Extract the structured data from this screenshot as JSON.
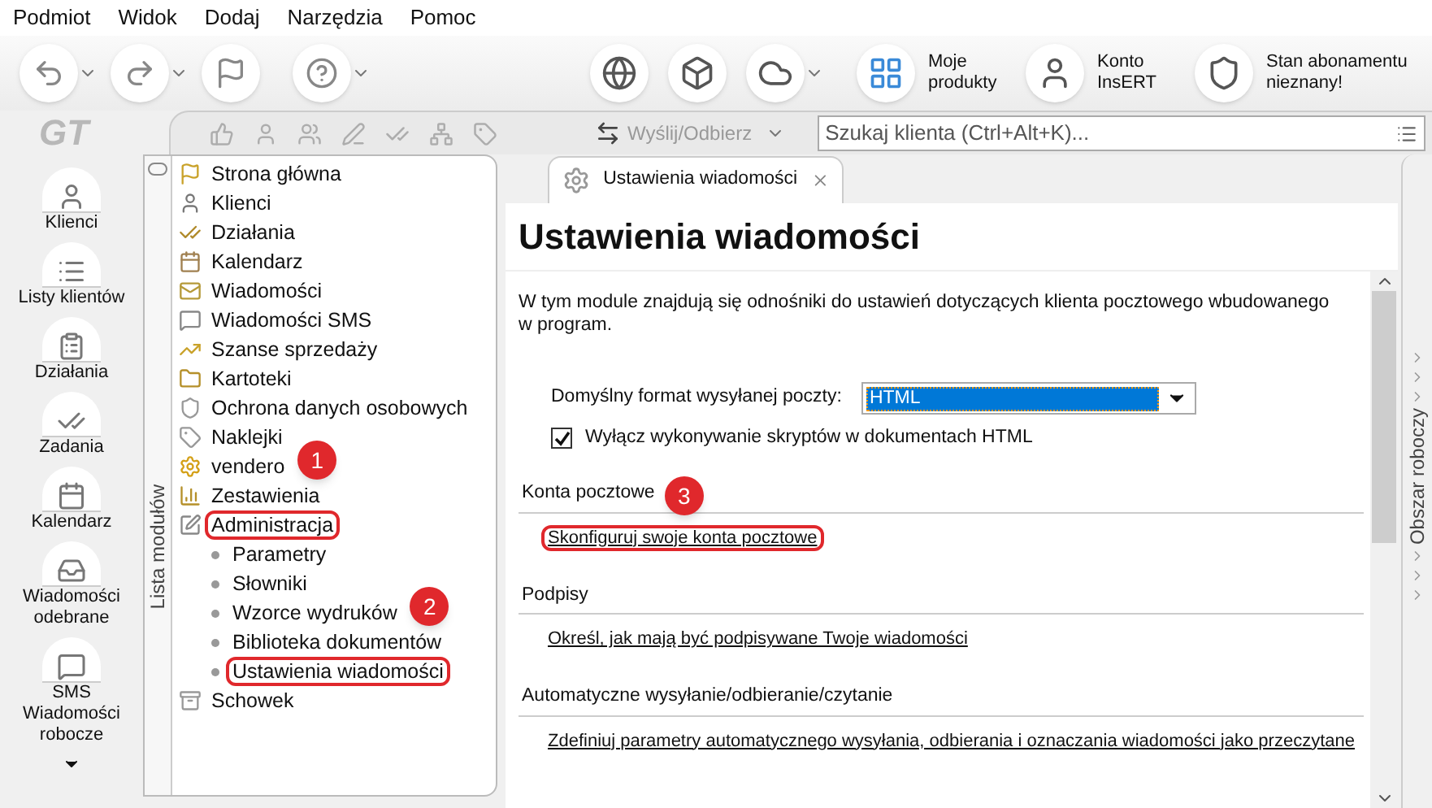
{
  "menu": [
    "Podmiot",
    "Widok",
    "Dodaj",
    "Narzędzia",
    "Pomoc"
  ],
  "toolbar": {
    "left": [
      {
        "kind": "arrow-left",
        "dropdown": true
      },
      {
        "kind": "arrow-right",
        "dropdown": true
      },
      {
        "kind": "flag",
        "dropdown": false
      },
      {
        "kind": "help",
        "dropdown": true
      }
    ],
    "right": [
      {
        "kind": "globe",
        "dropdown": false
      },
      {
        "kind": "cube",
        "dropdown": false
      },
      {
        "kind": "cloud",
        "dropdown": true
      }
    ],
    "labeled": [
      {
        "kind": "products",
        "label": "Moje produkty"
      },
      {
        "kind": "account",
        "label": "Konto InsERT"
      },
      {
        "kind": "shield",
        "label": "Stan abonamentu nieznany!"
      }
    ]
  },
  "logo": "GT",
  "subtoolbar": {
    "icons": [
      {
        "kind": "thumb",
        "disabled": true
      },
      {
        "kind": "user",
        "disabled": true
      },
      {
        "kind": "users",
        "disabled": true
      },
      {
        "kind": "pen",
        "disabled": true
      },
      {
        "kind": "check",
        "disabled": true
      },
      {
        "kind": "network",
        "disabled": true
      },
      {
        "kind": "tag",
        "disabled": true
      }
    ],
    "send": {
      "label": "Wyślij/Odbierz",
      "disabled": true
    },
    "search": {
      "placeholder": "Szukaj klienta (Ctrl+Alt+K)..."
    }
  },
  "sidebar": [
    {
      "kind": "clients",
      "label": "Klienci"
    },
    {
      "kind": "lists",
      "label": "Listy klientów"
    },
    {
      "kind": "actions",
      "label": "Działania"
    },
    {
      "kind": "tasks",
      "label": "Zadania"
    },
    {
      "kind": "calendar",
      "label": "Kalendarz"
    },
    {
      "kind": "inbox",
      "label": "Wiadomości odebrane"
    },
    {
      "kind": "sms",
      "label": "SMS Wiadomości robocze"
    }
  ],
  "modules": {
    "title": "Lista modułów",
    "items": [
      {
        "kind": "flag",
        "label": "Strona główna",
        "highlighted": false
      },
      {
        "kind": "user",
        "label": "Klienci",
        "highlighted": false
      },
      {
        "kind": "check",
        "label": "Działania",
        "highlighted": false
      },
      {
        "kind": "calendar",
        "label": "Kalendarz",
        "highlighted": false
      },
      {
        "kind": "mail",
        "label": "Wiadomości",
        "highlighted": false
      },
      {
        "kind": "sms",
        "label": "Wiadomości SMS",
        "highlighted": false
      },
      {
        "kind": "chance",
        "label": "Szanse sprzedaży",
        "highlighted": false
      },
      {
        "kind": "folder",
        "label": "Kartoteki",
        "highlighted": false
      },
      {
        "kind": "shield",
        "label": "Ochrona danych osobowych",
        "highlighted": false
      },
      {
        "kind": "tag",
        "label": "Naklejki",
        "highlighted": false
      },
      {
        "kind": "gear",
        "label": "vendero",
        "highlighted": false,
        "badge": "1"
      },
      {
        "kind": "chart",
        "label": "Zestawienia",
        "highlighted": false
      },
      {
        "kind": "edit",
        "label": "Administracja",
        "highlighted": true,
        "children": [
          {
            "label": "Parametry",
            "highlighted": false
          },
          {
            "label": "Słowniki",
            "highlighted": false
          },
          {
            "label": "Wzorce wydruków",
            "highlighted": false,
            "badge": "2"
          },
          {
            "label": "Biblioteka dokumentów",
            "highlighted": false
          },
          {
            "label": "Ustawienia wiadomości",
            "highlighted": true
          }
        ]
      },
      {
        "kind": "box",
        "label": "Schowek",
        "highlighted": false
      }
    ]
  },
  "tab": {
    "label": "Ustawienia wiadomości",
    "selected": true
  },
  "page": {
    "title": "Ustawienia wiadomości",
    "intro": "W tym module znajdują się odnośniki do ustawień dotyczących klienta pocztowego wbudowanego w program.",
    "format": {
      "label": "Domyślny format wysyłanej poczty:",
      "value": "HTML"
    },
    "scripts": {
      "label": "Wyłącz wykonywanie skryptów w dokumentach HTML",
      "checked": true
    },
    "sections": [
      {
        "title": "Konta pocztowe",
        "link": "Skonfiguruj swoje konta pocztowe",
        "highlighted": true,
        "badge": "3"
      },
      {
        "title": "Podpisy",
        "link": "Określ, jak mają być podpisywane Twoje wiadomości",
        "highlighted": false
      },
      {
        "title": "Automatyczne wysyłanie/odbieranie/czytanie",
        "link": "Zdefiniuj parametry automatycznego wysyłania, odbierania i oznaczania wiadomości jako przeczytane",
        "highlighted": false
      }
    ]
  },
  "workspace": {
    "title": "Obszar roboczy"
  }
}
